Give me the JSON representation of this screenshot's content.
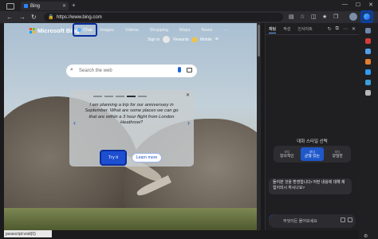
{
  "browser": {
    "tab_title": "Bing",
    "url": "https://www.bing.com",
    "status_text": "javascript:void(0)"
  },
  "bing": {
    "logo_text": "Microsoft Bing",
    "nav": [
      "Chat",
      "Images",
      "Videos",
      "Shopping",
      "Maps",
      "News"
    ],
    "nav_more": "⋯",
    "sign_in": "Sign in",
    "rewards": "Rewards",
    "mobile": "Mobile",
    "search_placeholder": "Search the web",
    "card_prompt": "I am planning a trip for our anniversary in September. What are some places we can go that are within a 3 hour flight from London Heathrow?",
    "try_it": "Try it",
    "learn_more": "Learn more"
  },
  "sidebar": {
    "tabs": [
      "채팅",
      "작성",
      "인사이트"
    ],
    "style_title": "대화 스타일 선택",
    "styles": [
      {
        "top": "보다",
        "label": "창의적인"
      },
      {
        "top": "보다",
        "label": "균형 있는"
      },
      {
        "top": "보다",
        "label": "정밀한"
      }
    ],
    "message": "들어본 것을 환영합니다! 어떤 내용에 대해 제 힘이되시 하시나요?",
    "composer_placeholder": "무엇이든 물어보세요"
  },
  "colors": {
    "accent": "#1f58c9",
    "highlight_border": "#0a2e9e"
  }
}
